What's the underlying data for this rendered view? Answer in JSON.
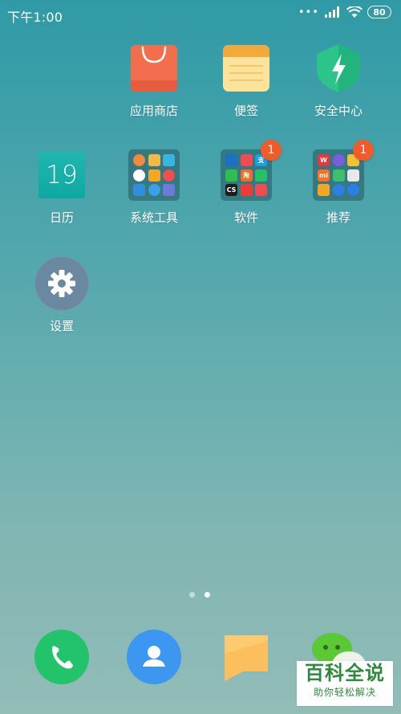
{
  "status_bar": {
    "time": "下午1:00",
    "dots": "•••",
    "battery": "80"
  },
  "apps": {
    "store": {
      "label": "应用商店",
      "color": "#f36e4d"
    },
    "notes": {
      "label": "便签",
      "color": "#f0a93b"
    },
    "security": {
      "label": "安全中心",
      "color": "#2bc48a"
    },
    "calendar": {
      "label": "日历",
      "day": "19",
      "color": "#12aca5"
    },
    "tools": {
      "label": "系统工具"
    },
    "software": {
      "label": "软件",
      "badge": "1"
    },
    "recommend": {
      "label": "推荐",
      "badge": "1"
    },
    "settings": {
      "label": "设置",
      "color": "#6a889f"
    }
  },
  "folders": {
    "tools_icons": [
      {
        "icon": "calculator-icon",
        "color": "#f08a3c",
        "text": "",
        "round": true
      },
      {
        "icon": "file-manager-icon",
        "color": "#f3b946",
        "text": "",
        "round": false
      },
      {
        "icon": "mail-icon",
        "color": "#37b4e0",
        "text": "",
        "round": false
      },
      {
        "icon": "clock-icon",
        "color": "#ffffff",
        "text": "",
        "round": true
      },
      {
        "icon": "compass-icon",
        "color": "#f5a623",
        "text": "",
        "round": false
      },
      {
        "icon": "recorder-icon",
        "color": "#f14e4e",
        "text": "",
        "round": true
      },
      {
        "icon": "pen-icon",
        "color": "#2f8fd8",
        "text": "",
        "round": false
      },
      {
        "icon": "gear-mini-icon",
        "color": "#3aa0e8",
        "text": "",
        "round": true
      },
      {
        "icon": "scan-icon",
        "color": "#6d7bd8",
        "text": "",
        "round": false
      }
    ],
    "software_icons": [
      {
        "icon": "ctrip-icon",
        "color": "#1e6fc7",
        "text": "",
        "round": false
      },
      {
        "icon": "pocket-icon",
        "color": "#f14a52",
        "text": "",
        "round": false
      },
      {
        "icon": "alipay-icon",
        "color": "#1a9fe6",
        "text": "支",
        "round": false
      },
      {
        "icon": "iqiyi-icon",
        "color": "#2fbf4f",
        "text": "",
        "round": false
      },
      {
        "icon": "taobao-icon",
        "color": "#f36c21",
        "text": "淘",
        "round": false
      },
      {
        "icon": "app-icon",
        "color": "#25c06a",
        "text": "",
        "round": false
      },
      {
        "icon": "camscanner-icon",
        "color": "#1d1d1d",
        "text": "CS",
        "round": false
      },
      {
        "icon": "toutiao-icon",
        "color": "#ee3a3a",
        "text": "",
        "round": false
      },
      {
        "icon": "umbrella-icon",
        "color": "#f14a52",
        "text": "",
        "round": false
      }
    ],
    "recommend_icons": [
      {
        "icon": "wps-icon",
        "color": "#e8373e",
        "text": "W",
        "round": false
      },
      {
        "icon": "star-icon",
        "color": "#7b5ee0",
        "text": "",
        "round": true
      },
      {
        "icon": "gallery-icon",
        "color": "#f1c232",
        "text": "",
        "round": false
      },
      {
        "icon": "mi-icon",
        "color": "#ff6d1f",
        "text": "mi",
        "round": false
      },
      {
        "icon": "bag-icon",
        "color": "#3cc06e",
        "text": "",
        "round": false
      },
      {
        "icon": "play-store-icon",
        "color": "#e8e8e8",
        "text": "",
        "round": false
      },
      {
        "icon": "phone-mini-icon",
        "color": "#f5a623",
        "text": "",
        "round": false
      },
      {
        "icon": "browser-icon",
        "color": "#2b80e6",
        "text": "",
        "round": true
      },
      {
        "icon": "edge-icon",
        "color": "#2c7de8",
        "text": "",
        "round": true
      }
    ]
  },
  "dock": {
    "phone_color": "#22c36a",
    "contacts_color": "#3b97f0",
    "messages_color": "#fbc05d",
    "wechat_color": "#5bc836"
  },
  "watermark": {
    "title": "百科全说",
    "subtitle": "助你轻松解决"
  }
}
